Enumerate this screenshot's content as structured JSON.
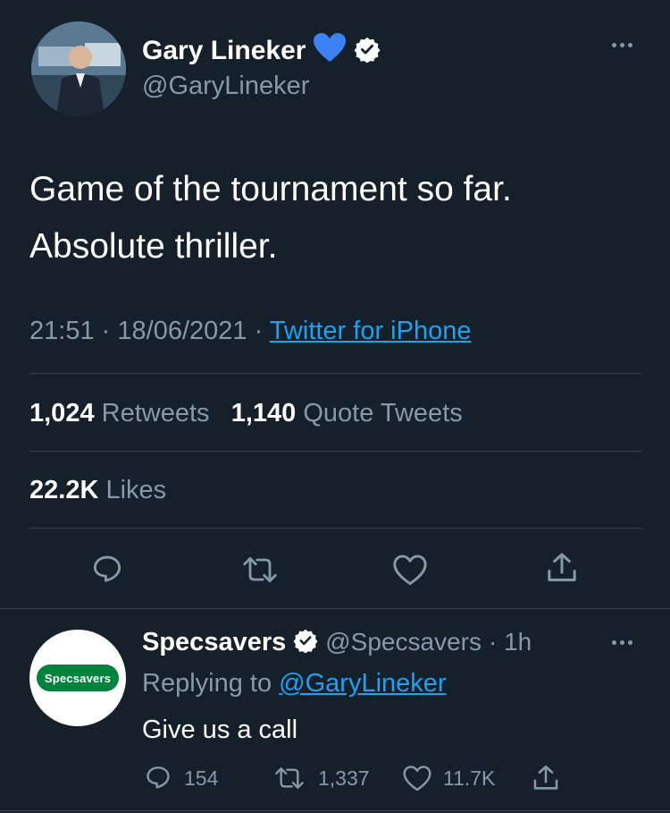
{
  "tweet": {
    "author": {
      "display_name": "Gary Lineker",
      "emoji": "💙",
      "handle": "@GaryLineker"
    },
    "text": "Game of the tournament so far. Absolute thriller.",
    "time": "21:51",
    "date": "18/06/2021",
    "separator": "·",
    "source": "Twitter for iPhone",
    "stats": {
      "retweets_count": "1,024",
      "retweets_label": "Retweets",
      "quote_count": "1,140",
      "quote_label": "Quote Tweets",
      "likes_count": "22.2K",
      "likes_label": "Likes"
    }
  },
  "reply": {
    "author": {
      "display_name": "Specsavers",
      "handle": "@Specsavers",
      "age": "· 1h",
      "logo_text": "Specsavers"
    },
    "replying_prefix": "Replying to",
    "replying_to": "@GaryLineker",
    "text": "Give us a call",
    "counts": {
      "replies": "154",
      "retweets": "1,337",
      "likes": "11.7K"
    }
  },
  "colors": {
    "background": "#15202b",
    "muted": "#8899a6",
    "accent": "#1da1f2",
    "verified": "#ffffff",
    "specsavers_green": "#00843d"
  },
  "icons": [
    "verified-badge-icon",
    "more-icon",
    "reply-icon",
    "retweet-icon",
    "like-icon",
    "share-icon"
  ]
}
